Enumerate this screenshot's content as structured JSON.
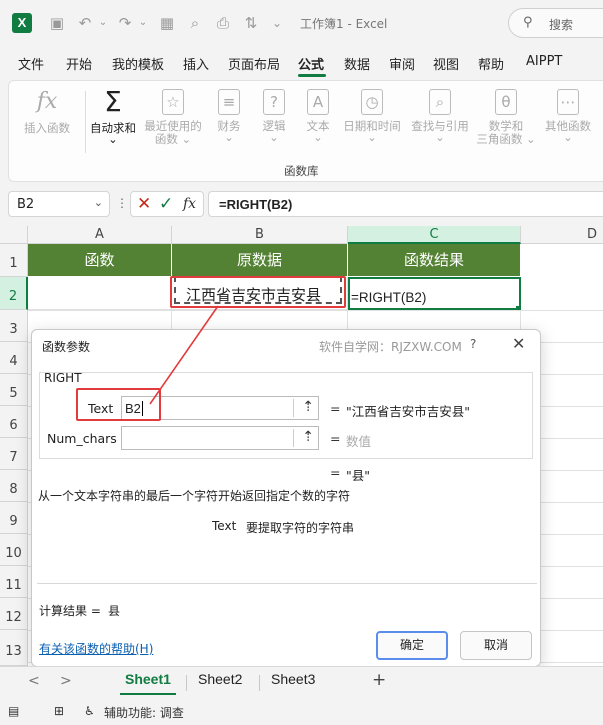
{
  "titlebar": {
    "app_badge": "X",
    "doc_title": "工作簿1 - Excel",
    "search_label": "搜索",
    "icons": [
      "save-icon",
      "undo-icon",
      "redo-icon",
      "form-icon",
      "print-preview-icon",
      "customize-icon"
    ]
  },
  "menu": {
    "items": [
      "文件",
      "开始",
      "我的模板",
      "插入",
      "页面布局",
      "公式",
      "数据",
      "审阅",
      "视图",
      "帮助",
      "AIPPT"
    ],
    "active": "公式"
  },
  "ribbon": {
    "buttons": [
      {
        "icon": "fx",
        "label1": "插入函数",
        "label2": ""
      },
      {
        "icon": "Σ",
        "label1": "自动求和",
        "label2": "⌄"
      },
      {
        "icon": "☆",
        "label1": "最近使用的",
        "label2": "函数 ⌄"
      },
      {
        "icon": "≡",
        "label1": "财务",
        "label2": "⌄"
      },
      {
        "icon": "?",
        "label1": "逻辑",
        "label2": "⌄"
      },
      {
        "icon": "A",
        "label1": "文本",
        "label2": "⌄"
      },
      {
        "icon": "◷",
        "label1": "日期和时间",
        "label2": "⌄"
      },
      {
        "icon": "⌕",
        "label1": "查找与引用",
        "label2": "⌄"
      },
      {
        "icon": "θ",
        "label1": "数学和",
        "label2": "三角函数 ⌄"
      },
      {
        "icon": "⋯",
        "label1": "其他函数",
        "label2": "⌄"
      }
    ],
    "group_label": "函数库"
  },
  "formula_bar": {
    "name_box": "B2",
    "formula": "=RIGHT(B2)"
  },
  "sheet": {
    "columns": [
      "A",
      "B",
      "C",
      "D"
    ],
    "rows": [
      "1",
      "2",
      "3",
      "4",
      "5",
      "6",
      "7",
      "8",
      "9",
      "10",
      "11",
      "12",
      "13"
    ],
    "header_row": [
      "函数",
      "原数据",
      "函数结果"
    ],
    "b2": "江西省吉安市吉安县",
    "c2": "=RIGHT(B2)"
  },
  "dialog": {
    "title": "函数参数",
    "watermark": "软件自学网：RJZXW.COM",
    "help_mark": "?",
    "close": "✕",
    "function_name": "RIGHT",
    "args": [
      {
        "label": "Text",
        "value": "B2",
        "result": "\"江西省吉安市吉安县\""
      },
      {
        "label": "Num_chars",
        "value": "",
        "result": "数值"
      }
    ],
    "eq": "=",
    "overall_result": "\"县\"",
    "description": "从一个文本字符串的最后一个字符开始返回指定个数的字符",
    "arg_help_name": "Text",
    "arg_help_text": "要提取字符的字符串",
    "calc_label": "计算结果 =",
    "calc_value": "县",
    "help_link": "有关该函数的帮助(H)",
    "ok": "确定",
    "cancel": "取消"
  },
  "sheet_tabs": {
    "prev": "<",
    "next": ">",
    "tabs": [
      "Sheet1",
      "Sheet2",
      "Sheet3"
    ],
    "active": "Sheet1",
    "add": "+"
  },
  "status": {
    "accessibility": "辅助功能: 调查"
  },
  "colors": {
    "excel_green": "#107c41",
    "header_fill": "#548235",
    "annotation_red": "#e23b3b"
  }
}
